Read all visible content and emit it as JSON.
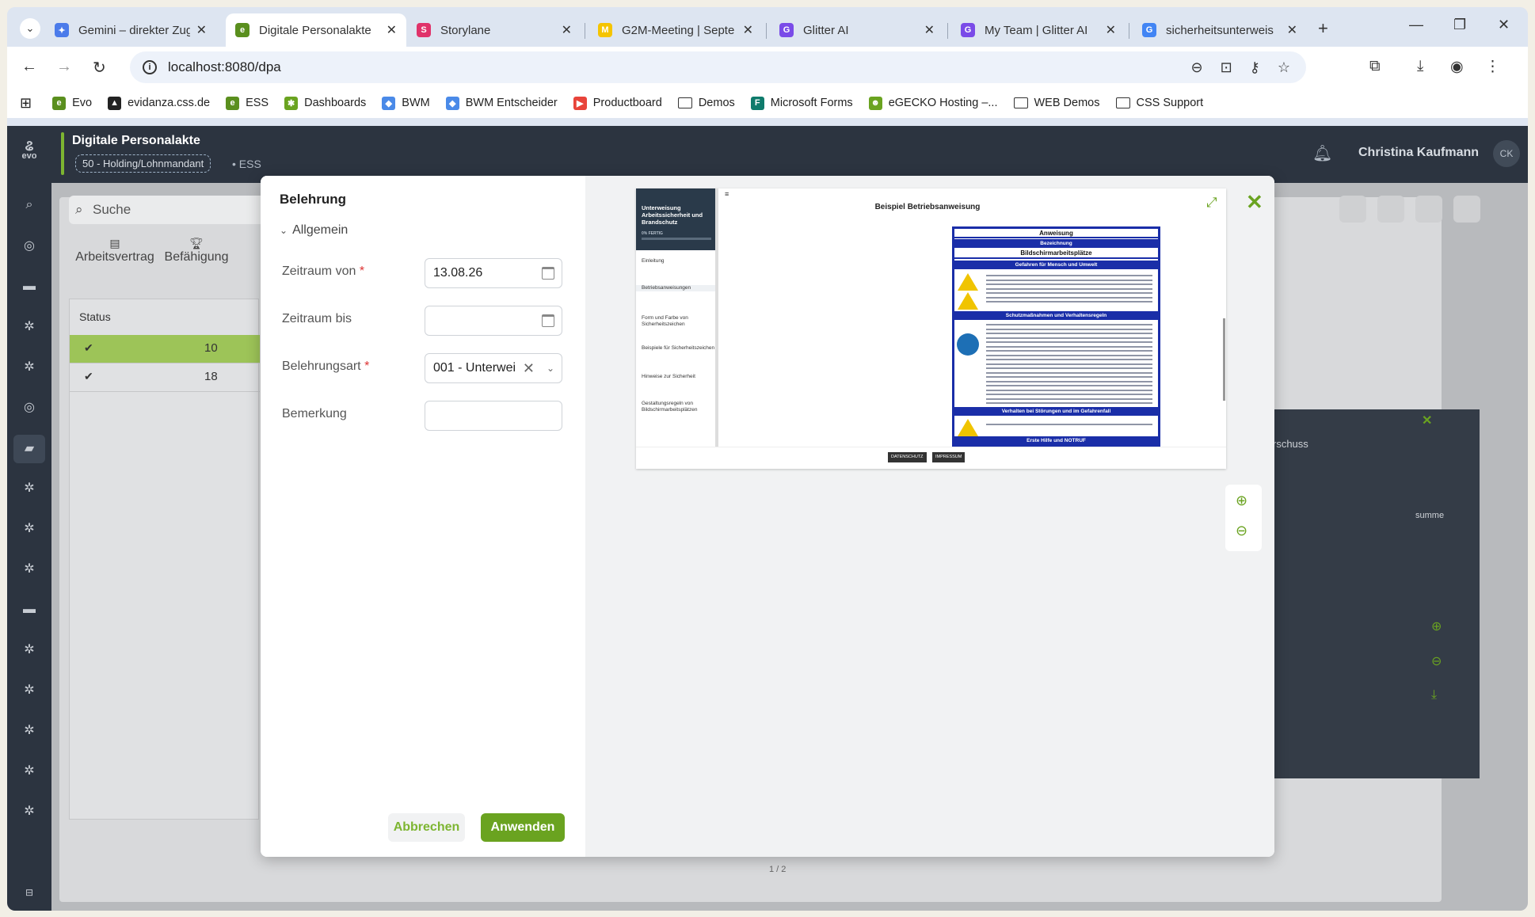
{
  "browser": {
    "tabs": [
      {
        "title": "Gemini – direkter Zug",
        "color": "#4b7bea",
        "glyph": "✦"
      },
      {
        "title": "Digitale Personalakte",
        "color": "#5a8f1e",
        "glyph": "e",
        "active": true
      },
      {
        "title": "Storylane",
        "color": "#e0336a",
        "glyph": "S"
      },
      {
        "title": "G2M-Meeting | Septe",
        "color": "#f5c400",
        "glyph": "M"
      },
      {
        "title": "Glitter AI",
        "color": "#7a4be8",
        "glyph": "G"
      },
      {
        "title": "My Team | Glitter AI",
        "color": "#7a4be8",
        "glyph": "G"
      },
      {
        "title": "sicherheitsunterweis",
        "color": "#4285f4",
        "glyph": "G"
      }
    ],
    "url": "localhost:8080/dpa",
    "bookmarks": [
      {
        "label": "Evo",
        "type": "site",
        "color": "#5a8f1e",
        "glyph": "e"
      },
      {
        "label": "evidanza.css.de",
        "type": "site",
        "color": "#222",
        "glyph": "▲"
      },
      {
        "label": "ESS",
        "type": "site",
        "color": "#5a8f1e",
        "glyph": "e"
      },
      {
        "label": "Dashboards",
        "type": "site",
        "color": "#6aa320",
        "glyph": "✱"
      },
      {
        "label": "BWM",
        "type": "site",
        "color": "#4a8ae8",
        "glyph": "◆"
      },
      {
        "label": "BWM Entscheider",
        "type": "site",
        "color": "#4a8ae8",
        "glyph": "◆"
      },
      {
        "label": "Productboard",
        "type": "site",
        "color": "#e8443a",
        "glyph": "▶"
      },
      {
        "label": "Demos",
        "type": "folder"
      },
      {
        "label": "Microsoft Forms",
        "type": "site",
        "color": "#0f7b6c",
        "glyph": "F"
      },
      {
        "label": "eGECKO Hosting –...",
        "type": "site",
        "color": "#6aa320",
        "glyph": "☻"
      },
      {
        "label": "WEB Demos",
        "type": "folder"
      },
      {
        "label": "CSS Support",
        "type": "folder"
      }
    ]
  },
  "app": {
    "logo": "evo",
    "title": "Digitale Personalakte",
    "mandant": "50 - Holding/Lohnmandant",
    "ess": "• ESS",
    "user": "Christina Kaufmann",
    "user_initials": "CK",
    "accent": "#6aa320"
  },
  "background": {
    "search_placeholder": "Suche",
    "tabs": [
      "Arbeitsvertrag",
      "Befähigung"
    ],
    "table_header": "Status",
    "rows": [
      {
        "value": "10"
      },
      {
        "value": "18"
      }
    ],
    "dark_panel_label": "rschuss",
    "dark_panel_col": "summe",
    "pager": "1 / 2"
  },
  "modal": {
    "title": "Belehrung",
    "section": "Allgemein",
    "fields": {
      "von_label": "Zeitraum von",
      "von_value": "13.08.26",
      "bis_label": "Zeitraum bis",
      "bis_value": "",
      "art_label": "Belehrungsart",
      "art_value": "001 - Unterwei",
      "bem_label": "Bemerkung",
      "bem_value": ""
    },
    "cancel": "Abbrechen",
    "apply": "Anwenden"
  },
  "preview_doc": {
    "nav_title": "Unterweisung Arbeitssicherheit und Brandschutz",
    "nav_progress": "0% FERTIG",
    "nav_items": [
      "Einleitung",
      "Betriebsanweisungen",
      "Form und Farbe von Sicherheitszeichen",
      "Beispiele für Sicherheitszeichen",
      "Hinweise zur Sicherheit",
      "Gestaltungsregeln von Bildschirmarbeitsplätzen"
    ],
    "doc_title": "Beispiel Betriebsanweisung",
    "sheet_title": "Anweisung",
    "sheet_sub": "Bezeichnung",
    "sheet_name": "Bildschirmarbeitsplätze",
    "sec_danger": "Gefahren für Mensch und Umwelt",
    "sec_protect": "Schutzmaßnahmen und Verhaltensregeln",
    "sec_fault": "Verhalten bei Störungen und im Gefahrenfall",
    "sec_firstaid": "Erste Hilfe und NOTRUF",
    "footer_buttons": [
      "DATENSCHUTZ",
      "IMPRESSUM"
    ]
  }
}
